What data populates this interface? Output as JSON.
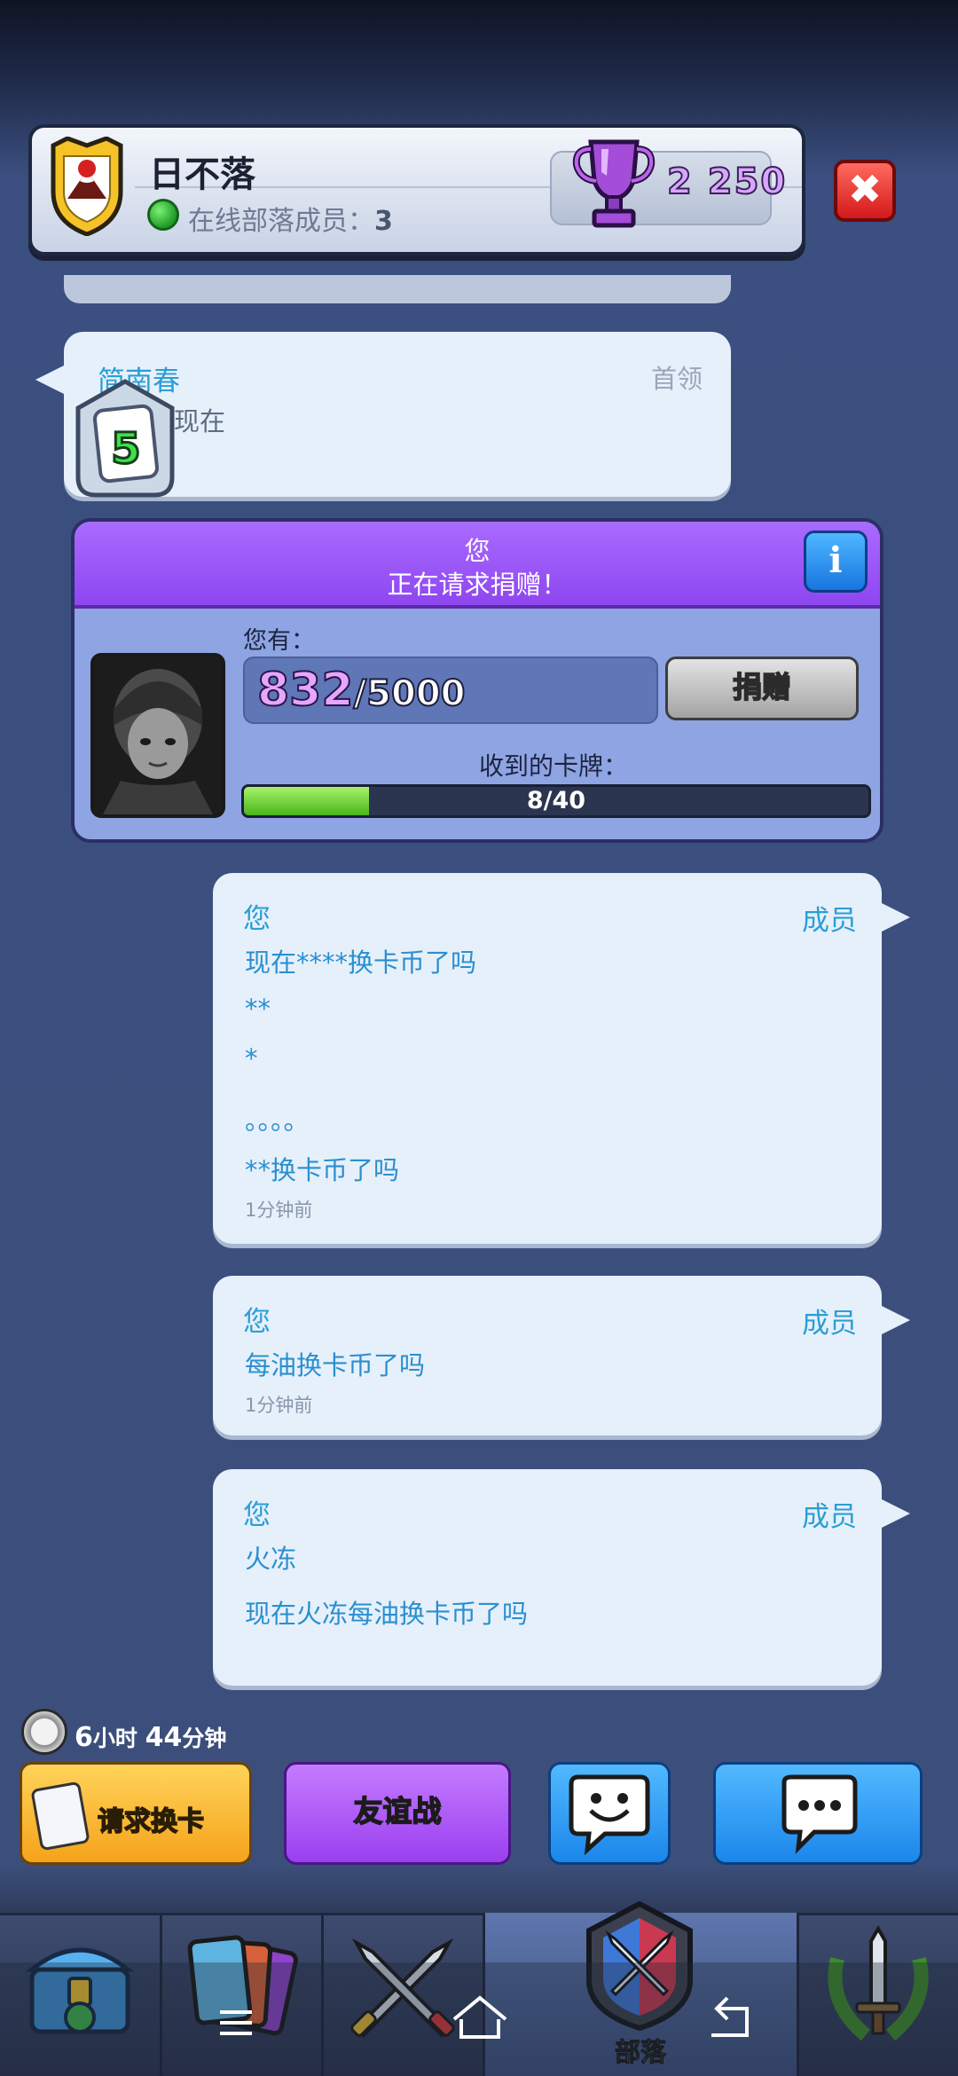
{
  "header": {
    "clan_name": "日不落",
    "online_label": "在线部落成员：",
    "online_count": "3",
    "trophies": "2 250",
    "icons": {
      "clan_badge": "shield-badge-icon",
      "trophy": "trophy-icon",
      "close": "close-icon",
      "online": "online-dot-icon"
    }
  },
  "leader_message": {
    "name": "简南春",
    "role": "首领",
    "text": "现在",
    "level": "5"
  },
  "donation_request": {
    "requester": "您",
    "status_text": "正在请求捐赠！",
    "have_label": "您有：",
    "have_count": "832",
    "have_total": "/5000",
    "donate_label": "捐赠",
    "received_label": "收到的卡牌：",
    "received": 8,
    "required": 40,
    "progress_text": "8/40",
    "info_label": "i"
  },
  "messages": [
    {
      "name": "您",
      "role": "成员",
      "lines": [
        "现在****换卡币了吗",
        "**",
        "*",
        "。。。。",
        "**换卡币了吗"
      ],
      "time": "1分钟前"
    },
    {
      "name": "您",
      "role": "成员",
      "lines": [
        "每油换卡币了吗"
      ],
      "time": "1分钟前"
    },
    {
      "name": "您",
      "role": "成员",
      "lines": [
        "火冻",
        "现在火冻每油换卡币了吗"
      ],
      "time": ""
    }
  ],
  "timer": {
    "hours": "6",
    "hours_unit": "小时",
    "minutes": "44",
    "minutes_unit": "分钟"
  },
  "actions": {
    "request_cards": "请求换卡",
    "friendly_battle": "友谊战",
    "emote_icon": "emote-face-icon",
    "chat_icon": "chat-bubble-icon"
  },
  "nav": {
    "items": [
      "shop-chest-icon",
      "cards-icon",
      "battle-swords-icon",
      "clan-icon",
      "tournament-icon"
    ],
    "active_label": "部落"
  },
  "colors": {
    "accent_blue": "#2a9ed6",
    "purple": "#9b3ff0",
    "orange": "#f5a31b",
    "green": "#4bb51c",
    "red": "#d3191a"
  }
}
